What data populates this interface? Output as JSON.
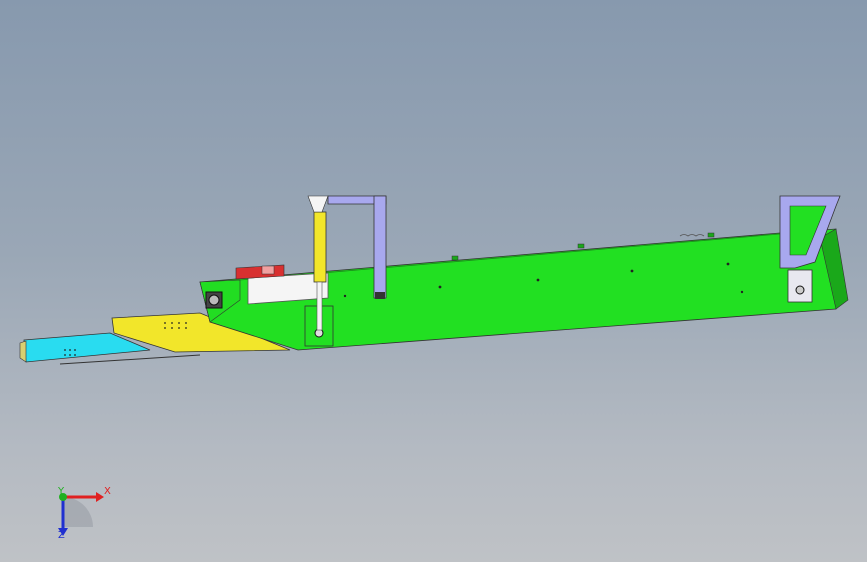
{
  "viewport": {
    "background_top": "#8799ae",
    "background_bottom": "#bfc2c6"
  },
  "model": {
    "colors": {
      "main_body": "#22e022",
      "main_body_dark": "#1aa81a",
      "yellow_plate": "#f2e62a",
      "cyan_plate": "#29dcf0",
      "frame": "#a8a8ee",
      "white_panel": "#f5f5f5",
      "red_part": "#d83030"
    }
  },
  "triad": {
    "x_label": "X",
    "y_label": "Y",
    "z_label": "Z",
    "x_color": "#e02020",
    "y_color": "#20b020",
    "z_color": "#2030d0"
  }
}
